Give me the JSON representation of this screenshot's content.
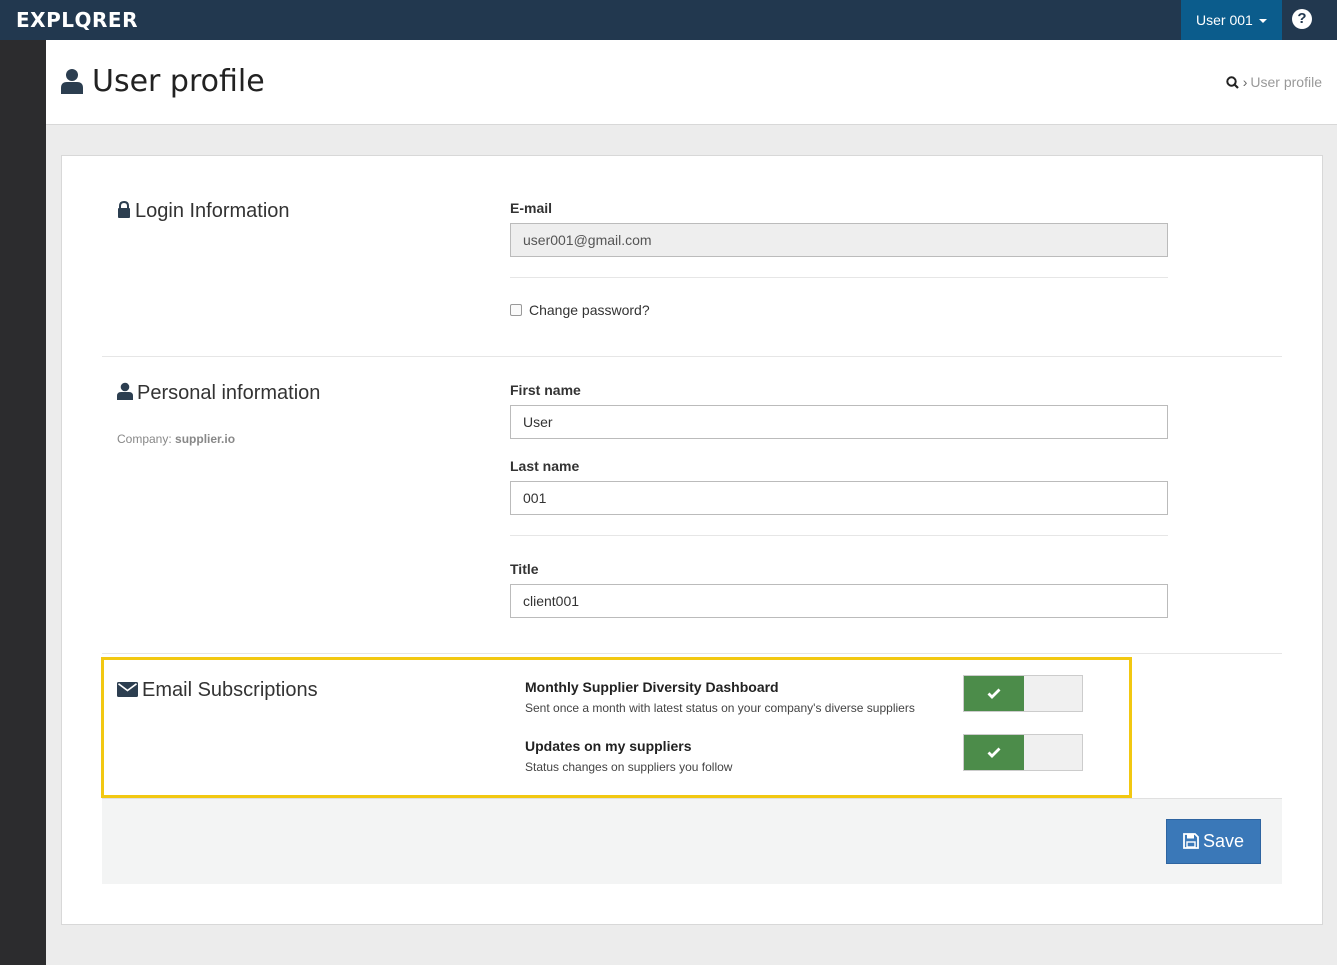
{
  "app": {
    "logo_before": "EXPL",
    "logo_q": "Q",
    "logo_after": "RER",
    "user_menu_label": "User 001",
    "help_glyph": "?"
  },
  "header": {
    "title": "User profile",
    "breadcrumb_current": "User profile",
    "breadcrumb_sep": "›"
  },
  "login": {
    "section_title": "Login Information",
    "email_label": "E-mail",
    "email_value": "user001@gmail.com",
    "change_password_label": "Change password?",
    "change_password_checked": false
  },
  "personal": {
    "section_title": "Personal information",
    "company_label": "Company:",
    "company_value": "supplier.io",
    "first_name_label": "First name",
    "first_name_value": "User",
    "last_name_label": "Last name",
    "last_name_value": "001",
    "title_label": "Title",
    "title_value": "client001"
  },
  "subscriptions": {
    "section_title": "Email Subscriptions",
    "items": [
      {
        "title": "Monthly Supplier Diversity Dashboard",
        "description": "Sent once a month with latest status on your company's diverse suppliers",
        "enabled": true
      },
      {
        "title": "Updates on my suppliers",
        "description": "Status changes on suppliers you follow",
        "enabled": true
      }
    ]
  },
  "actions": {
    "save_label": "Save"
  },
  "colors": {
    "topbar": "#22384f",
    "user_menu": "#0b5c8c",
    "toggle_on": "#4c8c4a",
    "highlight": "#f2c811",
    "save_button": "#3a78b8"
  },
  "icons": [
    "user-icon",
    "search-icon",
    "lock-icon",
    "envelope-icon",
    "check-icon",
    "save-icon",
    "help-icon",
    "caret-down-icon"
  ]
}
